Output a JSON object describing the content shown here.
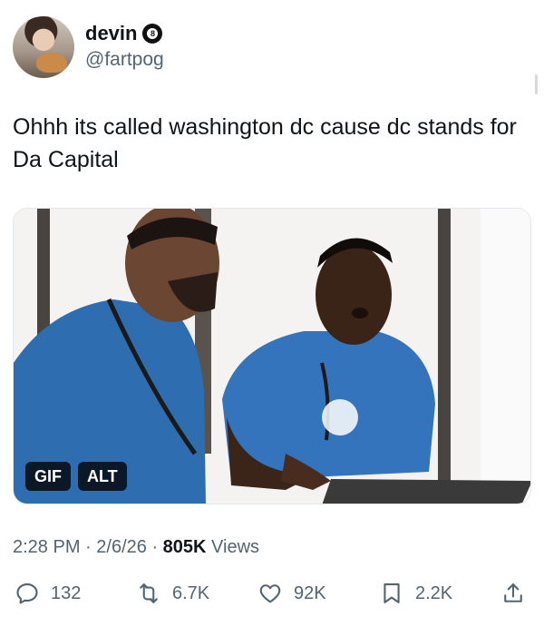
{
  "author": {
    "display_name": "devin",
    "badge_glyph": "8",
    "handle": "@fartpog"
  },
  "tweet": {
    "text": "Ohhh its called washington dc cause dc stands for Da Capital"
  },
  "media": {
    "gif_label": "GIF",
    "alt_label": "ALT"
  },
  "meta": {
    "time": "2:28 PM",
    "date": "2/6/26",
    "views_count": "805K",
    "views_label": "Views"
  },
  "actions": {
    "replies": "132",
    "reposts": "6.7K",
    "likes": "92K",
    "bookmarks": "2.2K"
  },
  "colors": {
    "text": "#0f1419",
    "secondary": "#536471",
    "shirt_blue": "#2f6fb3"
  }
}
